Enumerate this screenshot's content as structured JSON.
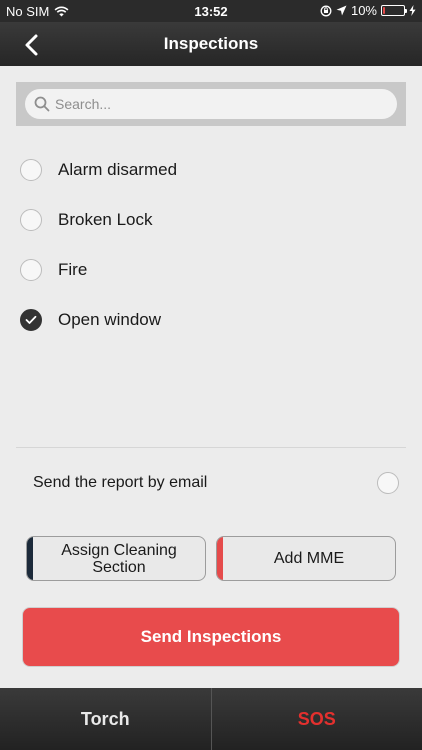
{
  "status_bar": {
    "carrier": "No SIM",
    "time": "13:52",
    "battery": "10%",
    "battery_level": 0.1
  },
  "nav": {
    "title": "Inspections",
    "back_icon": "chevron-left-icon"
  },
  "search": {
    "placeholder": "Search..."
  },
  "options": [
    {
      "label": "Alarm disarmed",
      "checked": false
    },
    {
      "label": "Broken Lock",
      "checked": false
    },
    {
      "label": "Fire",
      "checked": false
    },
    {
      "label": "Open window",
      "checked": true
    }
  ],
  "email": {
    "label": "Send the report by email",
    "checked": false
  },
  "buttons": {
    "assign": "Assign Cleaning Section",
    "add_mme": "Add MME",
    "send": "Send Inspections"
  },
  "tabs": {
    "torch": "Torch",
    "sos": "SOS"
  },
  "colors": {
    "accent_red": "#e84b4c",
    "accent_navy": "#1c2a3a",
    "sos_red": "#e4302e"
  }
}
